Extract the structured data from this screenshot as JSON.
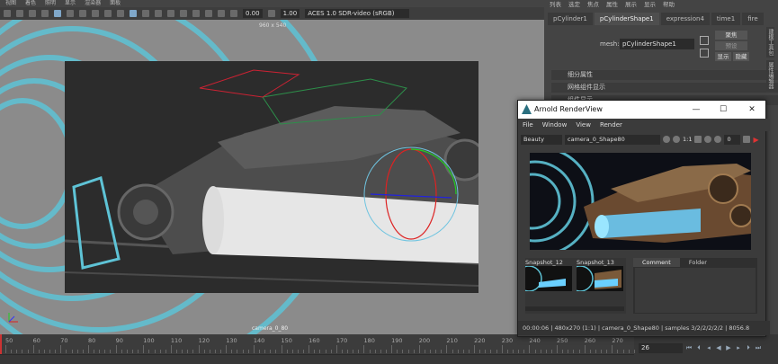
{
  "menubar": {
    "items": [
      "视图",
      "着色",
      "照明",
      "显示",
      "渲染器",
      "面板"
    ]
  },
  "toolbar": {
    "exposure": "0.00",
    "gamma": "1.00",
    "color_space": "ACES 1.0 SDR-video (sRGB)"
  },
  "viewport": {
    "resolution_label": "960 x 540",
    "camera_label": "camera_0_80"
  },
  "right_panel": {
    "menu": [
      "列表",
      "选定",
      "焦点",
      "属性",
      "展示",
      "显示",
      "帮助"
    ],
    "tabs": [
      "pCylinder1",
      "pCylinderShape1",
      "expression4",
      "time1",
      "fire"
    ],
    "active_tab": 1,
    "mesh_label": "mesh:",
    "mesh_value": "pCylinderShape1",
    "btn_focus": "聚焦",
    "btn_preset": "预设",
    "btn_show": "显示",
    "btn_hide": "隐藏",
    "sections": [
      "细分属性",
      "网格组件显示",
      "组件显示"
    ],
    "vertical_tabs": [
      "建模工具包",
      "属性编辑器"
    ]
  },
  "timeline": {
    "ticks": [
      "50",
      "60",
      "70",
      "80",
      "90",
      "100",
      "110",
      "120",
      "130",
      "140",
      "150",
      "160",
      "170",
      "180",
      "190",
      "200",
      "210",
      "220",
      "230",
      "240",
      "250",
      "260",
      "270"
    ],
    "current_frame": "26"
  },
  "arnold": {
    "title": "Arnold RenderView",
    "menu": [
      "File",
      "Window",
      "View",
      "Render"
    ],
    "aov": "Beauty",
    "camera": "camera_0_Shape80",
    "ratio": "1:1",
    "exposure": "0",
    "snapshots": [
      "Snapshot_12",
      "Snapshot_13"
    ],
    "comment_tabs": [
      "Comment",
      "Folder"
    ],
    "status": "00:00:06 | 480x270 (1:1) | camera_0_Shape80 | samples 3/2/2/2/2/2 | 8056.8"
  },
  "colors": {
    "accent": "#7fa7c9",
    "tunnel_cyan": "#5ec3d6",
    "render_glow": "#6ad0ff"
  }
}
